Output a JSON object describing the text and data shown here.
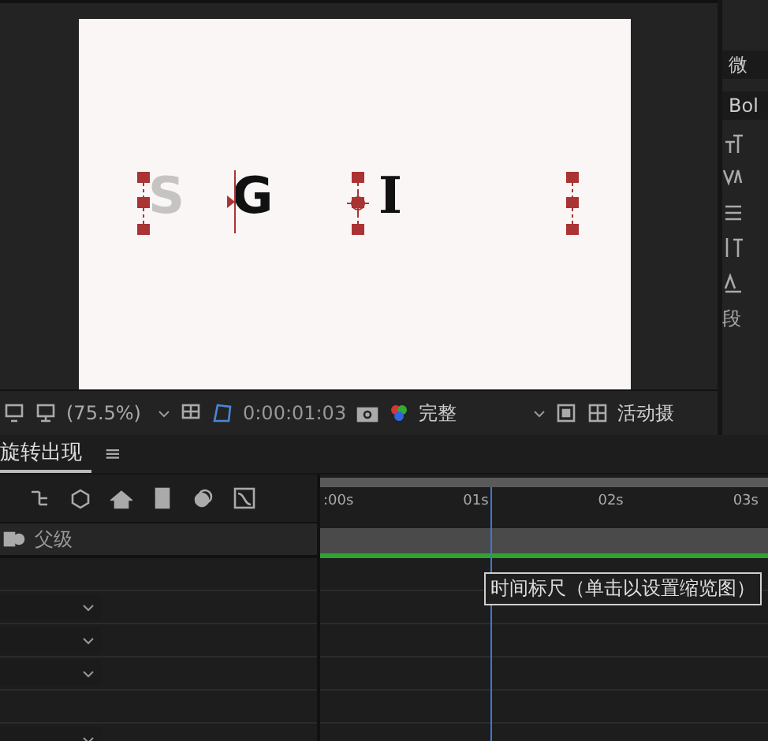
{
  "viewer": {
    "letters": [
      {
        "char": "S",
        "faded": true,
        "kind": "sans"
      },
      {
        "char": "G",
        "faded": false,
        "kind": "sans"
      },
      {
        "char": "I",
        "faded": false,
        "kind": "serif"
      }
    ],
    "toolbar": {
      "zoom": "(75.5%)",
      "timecode": "0:00:01:03",
      "resolution": "完整",
      "camera": "活动摄"
    }
  },
  "side_panel": {
    "font": "微",
    "style": "Bol",
    "section": "段"
  },
  "timeline": {
    "tab": {
      "label": "旋转出现",
      "selected": true
    },
    "menu_glyph": "≡",
    "column_header": "父级",
    "ruler": [
      ":00s",
      "01s",
      "02s",
      "03s"
    ],
    "tooltip": "时间标尺（单击以设置缩览图）",
    "rows": [
      {
        "kind": "dropdown"
      },
      {
        "kind": "dropdown"
      },
      {
        "kind": "dropdown"
      },
      {
        "kind": "empty"
      },
      {
        "kind": "dropdown"
      }
    ]
  }
}
